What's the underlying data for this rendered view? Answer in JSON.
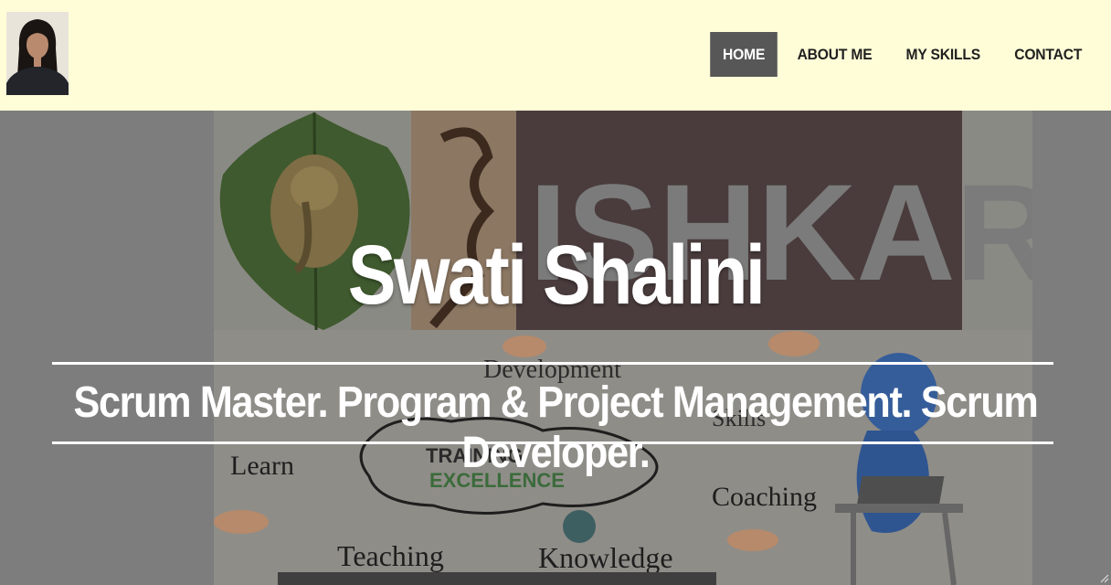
{
  "header": {
    "avatar_icon": "profile-photo",
    "nav": [
      {
        "label": "HOME",
        "active": true
      },
      {
        "label": "ABOUT ME",
        "active": false
      },
      {
        "label": "MY SKILLS",
        "active": false
      },
      {
        "label": "CONTACT",
        "active": false
      }
    ]
  },
  "hero": {
    "title": "Swati Shalini",
    "subtitle": "Scrum Master. Program & Project Management. Scrum Developer.",
    "image_text": {
      "banner": "ISHKARS",
      "development": "Development",
      "skills": "Skills",
      "learn": "Learn",
      "training": "TRAINING",
      "excellence": "EXCELLENCE",
      "coaching": "Coaching",
      "teaching": "Teaching",
      "knowledge": "Knowledge"
    }
  },
  "colors": {
    "header_bg": "#fffdd8",
    "nav_active_bg": "#575757",
    "hero_overlay": "#808080"
  }
}
